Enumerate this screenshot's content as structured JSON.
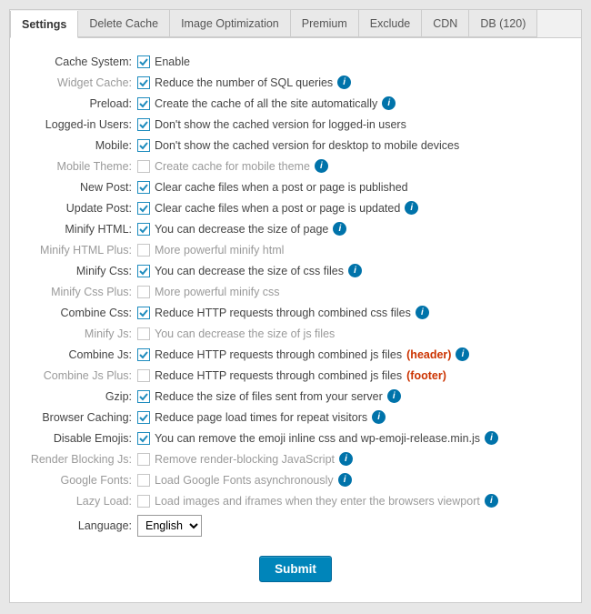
{
  "tabs": {
    "settings": "Settings",
    "delete_cache": "Delete Cache",
    "image_opt": "Image Optimization",
    "premium": "Premium",
    "exclude": "Exclude",
    "cdn": "CDN",
    "db": "DB (120)"
  },
  "rows": {
    "cache_system": {
      "label": "Cache System:",
      "text": "Enable"
    },
    "widget_cache": {
      "label": "Widget Cache:",
      "text": "Reduce the number of SQL queries"
    },
    "preload": {
      "label": "Preload:",
      "text": "Create the cache of all the site automatically"
    },
    "logged_in": {
      "label": "Logged-in Users:",
      "text": "Don't show the cached version for logged-in users"
    },
    "mobile": {
      "label": "Mobile:",
      "text": "Don't show the cached version for desktop to mobile devices"
    },
    "mobile_theme": {
      "label": "Mobile Theme:",
      "text": "Create cache for mobile theme"
    },
    "new_post": {
      "label": "New Post:",
      "text": "Clear cache files when a post or page is published"
    },
    "update_post": {
      "label": "Update Post:",
      "text": "Clear cache files when a post or page is updated"
    },
    "minify_html": {
      "label": "Minify HTML:",
      "text": "You can decrease the size of page"
    },
    "minify_html_plus": {
      "label": "Minify HTML Plus:",
      "text": "More powerful minify html"
    },
    "minify_css": {
      "label": "Minify Css:",
      "text": "You can decrease the size of css files"
    },
    "minify_css_plus": {
      "label": "Minify Css Plus:",
      "text": "More powerful minify css"
    },
    "combine_css": {
      "label": "Combine Css:",
      "text": "Reduce HTTP requests through combined css files"
    },
    "minify_js": {
      "label": "Minify Js:",
      "text": "You can decrease the size of js files"
    },
    "combine_js": {
      "label": "Combine Js:",
      "text": "Reduce HTTP requests through combined js files",
      "suffix": "(header)"
    },
    "combine_js_plus": {
      "label": "Combine Js Plus:",
      "text": "Reduce HTTP requests through combined js files",
      "suffix": "(footer)"
    },
    "gzip": {
      "label": "Gzip:",
      "text": "Reduce the size of files sent from your server"
    },
    "browser_caching": {
      "label": "Browser Caching:",
      "text": "Reduce page load times for repeat visitors"
    },
    "disable_emojis": {
      "label": "Disable Emojis:",
      "text": "You can remove the emoji inline css and wp-emoji-release.min.js"
    },
    "render_blocking": {
      "label": "Render Blocking Js:",
      "text": "Remove render-blocking JavaScript"
    },
    "google_fonts": {
      "label": "Google Fonts:",
      "text": "Load Google Fonts asynchronously"
    },
    "lazy_load": {
      "label": "Lazy Load:",
      "text": "Load images and iframes when they enter the browsers viewport"
    },
    "language": {
      "label": "Language:",
      "value": "English"
    }
  },
  "submit": "Submit"
}
